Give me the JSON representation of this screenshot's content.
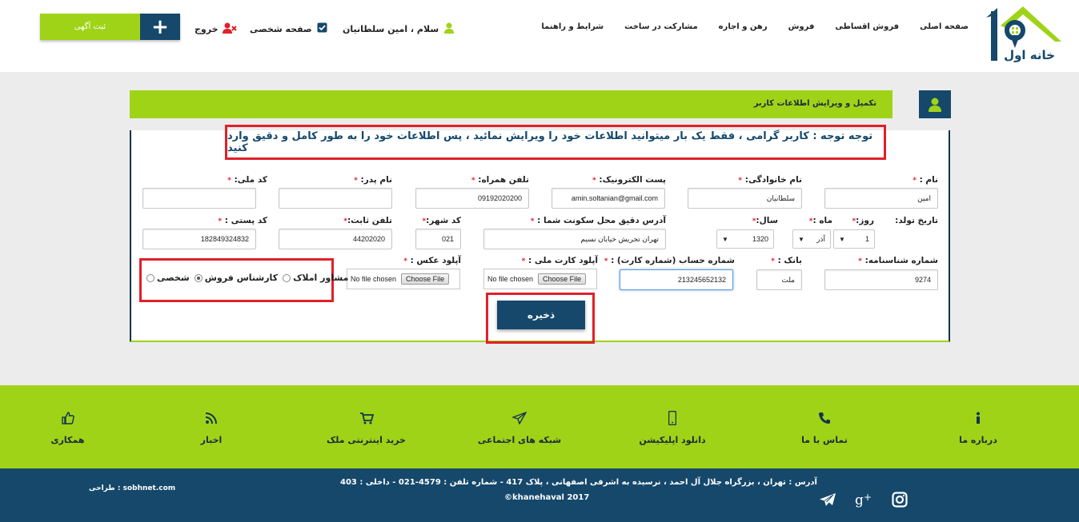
{
  "header": {
    "logo_text": "خانه اول",
    "nav": [
      "صفحه اصلی",
      "فروش اقساطی",
      "فروش",
      "رهن و اجاره",
      "مشارکت در ساخت",
      "شرایط و راهنما"
    ],
    "greeting": "سلام ، امین سلطانیان",
    "profile": "صفحه شخصی",
    "logout": "خروج",
    "post_ad": "ثبت آگهی",
    "post_ad_icon": "+"
  },
  "panel": {
    "title": "تکمیل و ویرایش اطلاعات کاربر",
    "notice": "توجه توجه : کاربر گرامی ، فقط یک بار میتوانید اطلاعات خود را ویرایش نمائید ، پس اطلاعات خود را به طور کامل و دقیق وارد کنید"
  },
  "form": {
    "first_name": {
      "label": "نام :",
      "value": "امین"
    },
    "last_name": {
      "label": "نام خانوادگی:",
      "value": "سلطانیان"
    },
    "email": {
      "label": "پست الکترونیک:",
      "value": "amin.soltanian@gmail.com"
    },
    "mobile": {
      "label": "تلفن همراه:",
      "value": "09192020200"
    },
    "father_name": {
      "label": "نام پدر:",
      "value": ""
    },
    "national_code": {
      "label": "کد ملی:",
      "value": ""
    },
    "birth_label": "تاریخ تولد:",
    "day": {
      "label": "روز:",
      "value": "1"
    },
    "month": {
      "label": "ماه :",
      "value": "آذر"
    },
    "year": {
      "label": "سال:",
      "value": "1320"
    },
    "address": {
      "label": "آدرس دقیق محل سکونت شما :",
      "value": "تهران تجریش خیابان نسیم"
    },
    "city_code": {
      "label": "کد شهر:",
      "value": "021"
    },
    "phone": {
      "label": "تلفن ثابت:",
      "value": "44202020"
    },
    "postal_code": {
      "label": "کد پستی :",
      "value": "182849324832"
    },
    "id_number": {
      "label": "شماره شناسنامه:",
      "value": "9274"
    },
    "bank": {
      "label": "بانک :",
      "value": "ملت"
    },
    "account": {
      "label": "شماره حساب (شماره کارت) :",
      "value": "213245652132"
    },
    "id_card_upload": {
      "label": "آپلود کارت ملی :",
      "button": "Choose File",
      "status": "No file chosen"
    },
    "photo_upload": {
      "label": "آپلود عکس :",
      "button": "Choose File",
      "status": "No file chosen"
    },
    "radios": [
      {
        "label": "مشاور املاک",
        "checked": false
      },
      {
        "label": "کارشناس فروش",
        "checked": true
      },
      {
        "label": "شخصی",
        "checked": false
      }
    ],
    "save": "ذخیره"
  },
  "footer": {
    "items": [
      {
        "label": "درباره ما",
        "icon": "info-icon"
      },
      {
        "label": "تماس با ما",
        "icon": "phone-icon"
      },
      {
        "label": "دانلود اپلیکیشن",
        "icon": "mobile-icon"
      },
      {
        "label": "شبکه های اجتماعی",
        "icon": "send-icon"
      },
      {
        "label": "خرید اینترنتی ملک",
        "icon": "cart-icon"
      },
      {
        "label": "اخبار",
        "icon": "rss-icon"
      },
      {
        "label": "همکاری",
        "icon": "thumbs-up-icon"
      }
    ],
    "address": "آدرس : تهران ، بزرگراه جلال آل احمد ، نرسیده به اشرفی اصفهانی ، پلاک 417 - شماره تلفن : 4579-021 - داخلی : 403",
    "copyright": "©khanehaval 2017",
    "designer": "طراحی : sobhnet.com",
    "social": [
      "instagram-icon",
      "google-plus-icon",
      "telegram-icon"
    ]
  },
  "colors": {
    "green": "#9fd318",
    "navy": "#15486b",
    "red": "#e0202a"
  }
}
